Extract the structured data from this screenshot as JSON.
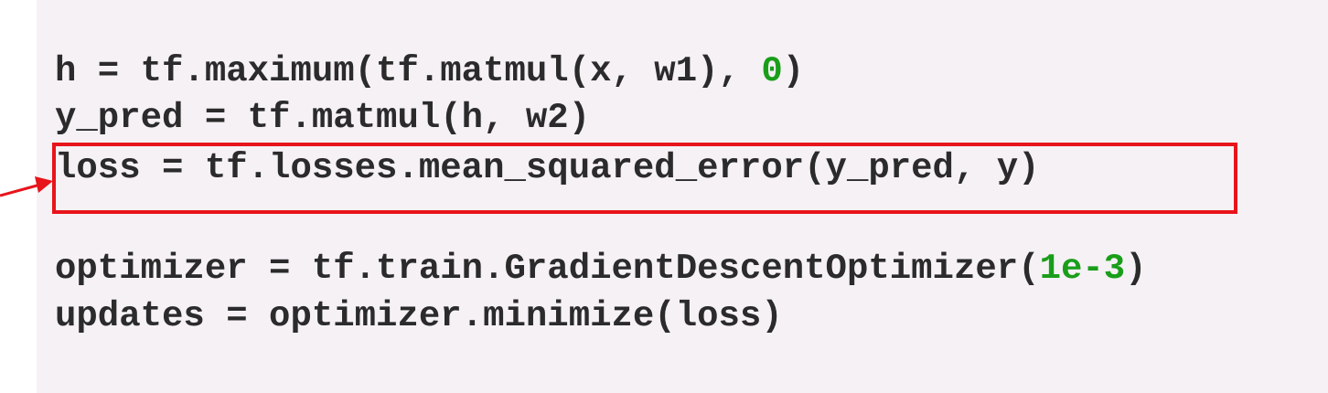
{
  "code": {
    "line1": {
      "prefix": "h = tf.maximum(tf.matmul(x, w1), ",
      "number": "0",
      "suffix": ")"
    },
    "line2": "y_pred = tf.matmul(h, w2)",
    "line3": "loss = tf.losses.mean_squared_error(y_pred, y)",
    "line4": {
      "prefix": "optimizer = tf.train.GradientDescentOptimizer(",
      "number": "1e-3",
      "suffix": ")"
    },
    "line5": "updates = optimizer.minimize(loss)"
  },
  "colors": {
    "background": "#f5f1f5",
    "text": "#2b2b2b",
    "number": "#1a9e1a",
    "highlight": "#e8141b"
  }
}
